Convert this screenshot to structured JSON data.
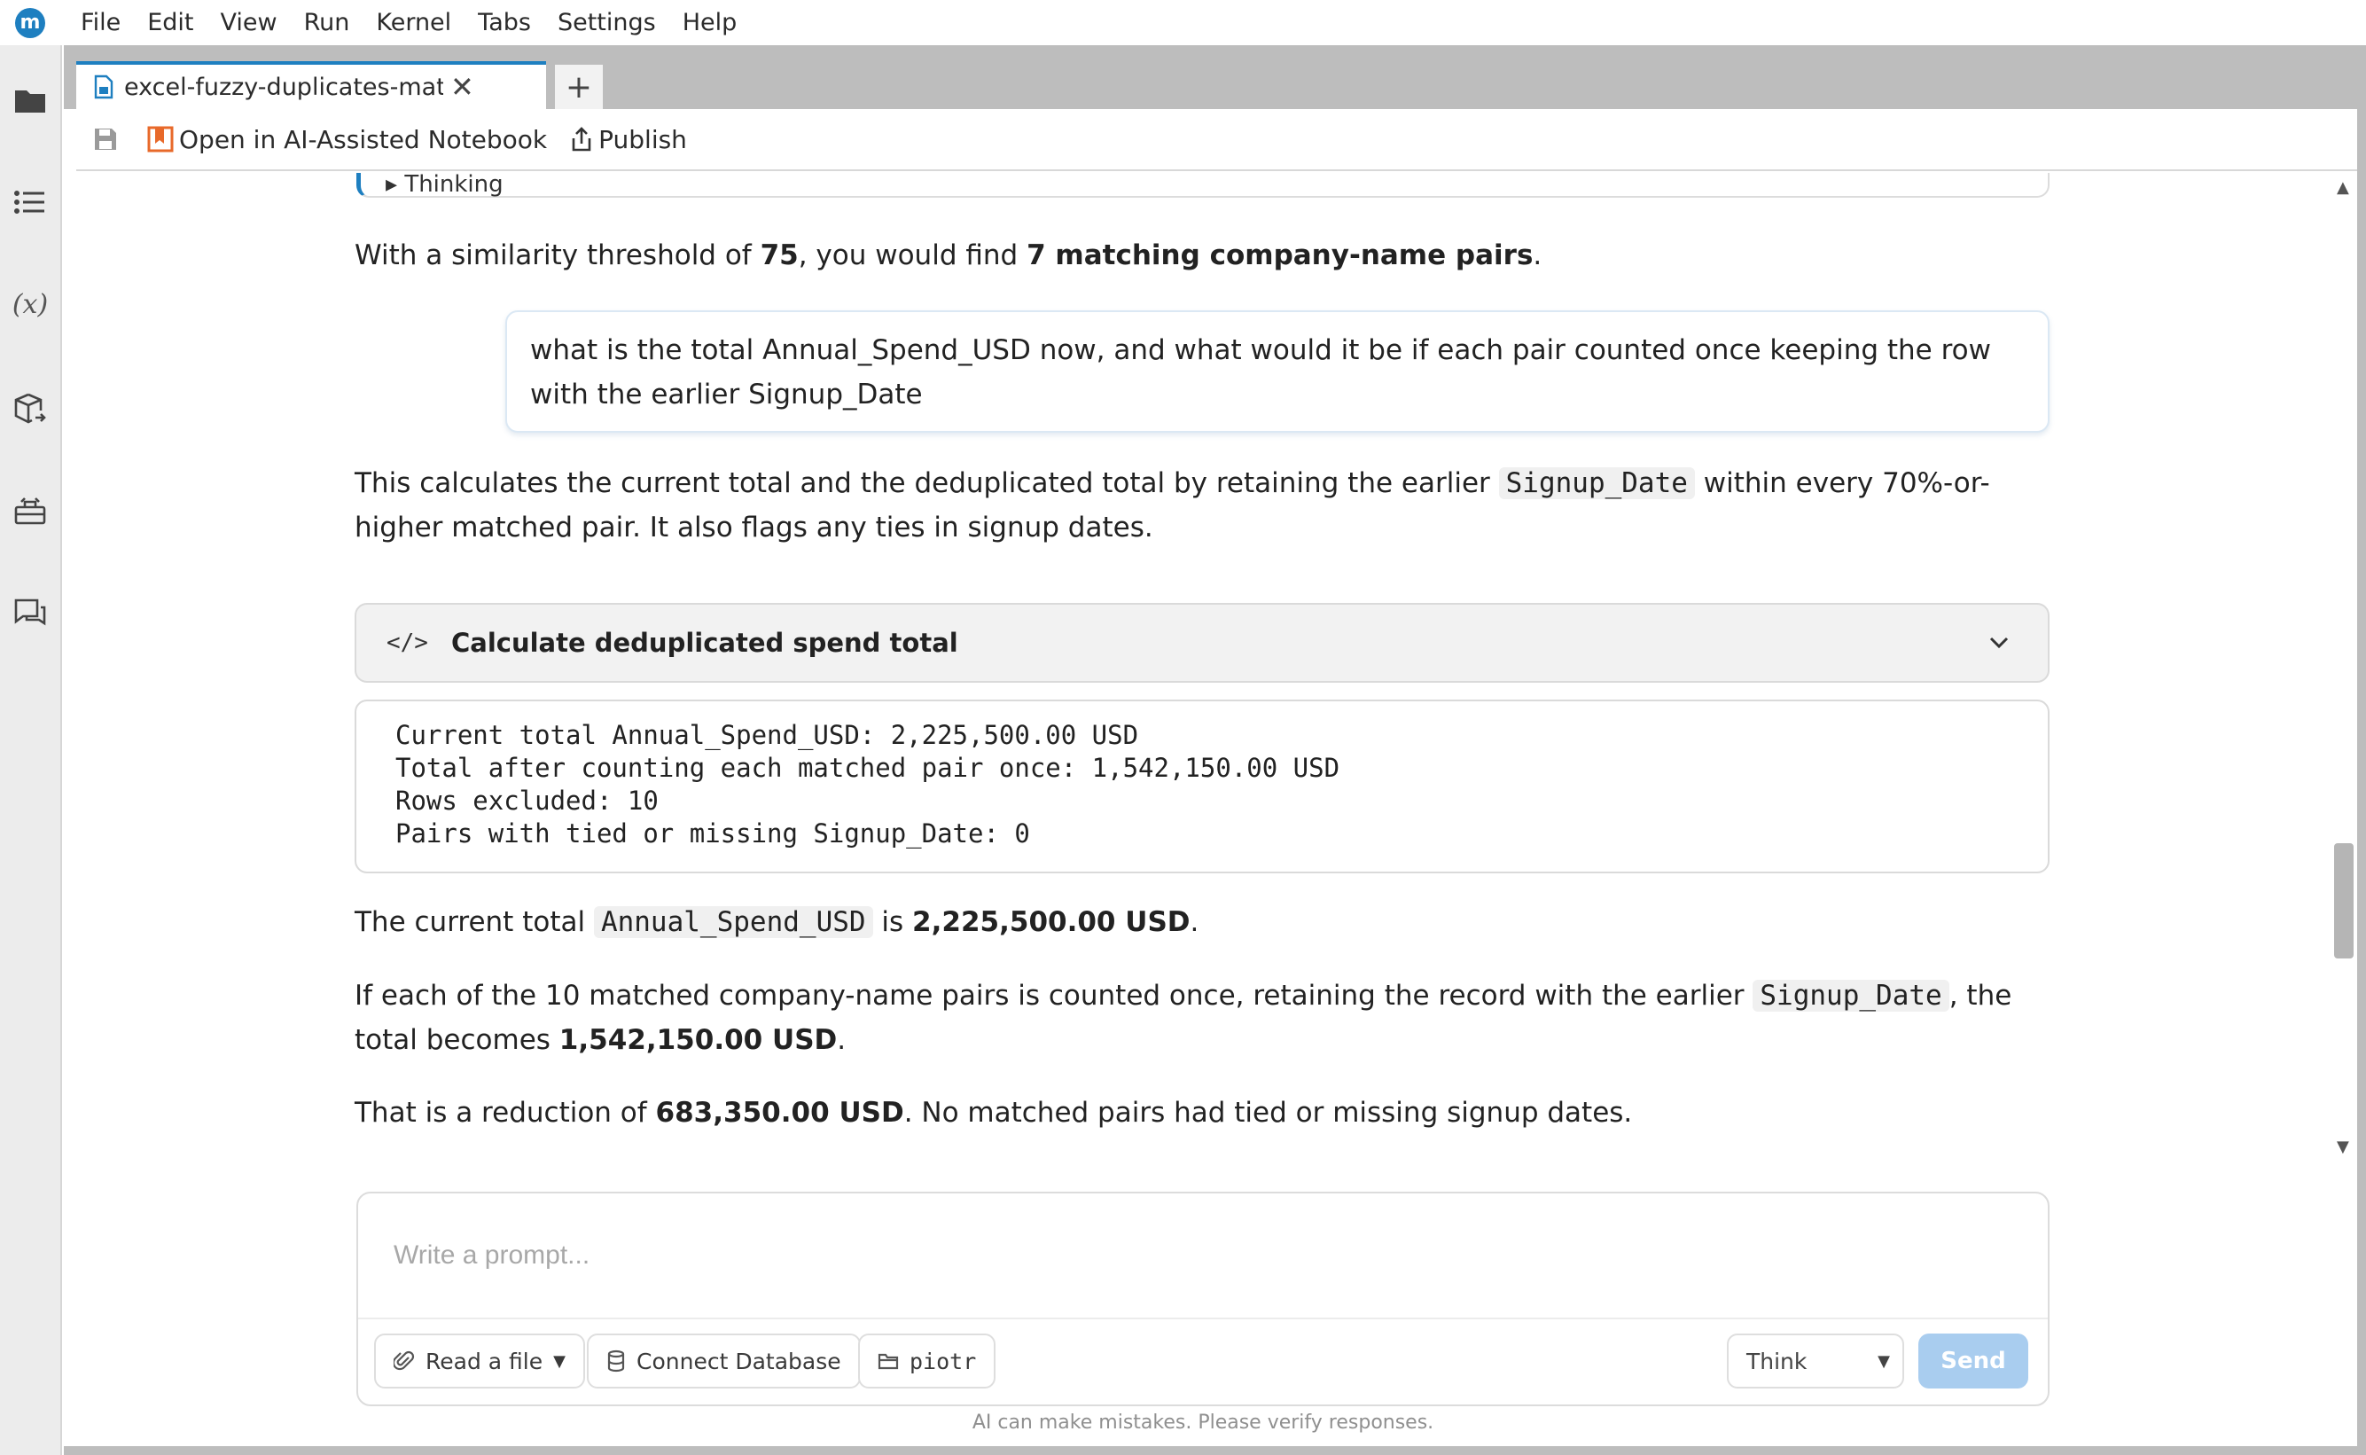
{
  "app": {
    "logo_letter": "m",
    "menu": [
      "File",
      "Edit",
      "View",
      "Run",
      "Kernel",
      "Tabs",
      "Settings",
      "Help"
    ]
  },
  "rail": {
    "icons": [
      "folder-icon",
      "list-icon",
      "variables-icon",
      "package-icon",
      "toolbox-icon",
      "chat-icon"
    ],
    "variables_text": "(x)"
  },
  "tabs": {
    "active_label": "excel-fuzzy-duplicates-match",
    "close_glyph": "✕",
    "new_tab_glyph": "+"
  },
  "toolbar": {
    "open_ai_label": "Open in AI-Assisted Notebook",
    "publish_label": "Publish"
  },
  "chat": {
    "prev_block_label": "▸ Thinking",
    "para1": {
      "pre": "With a similarity threshold of ",
      "b1": "75",
      "mid": ", you would find ",
      "b2": "7 matching company-name pairs",
      "post": "."
    },
    "user_message": "what is the total Annual_Spend_USD now, and what would it be if each pair counted once keeping the row with the earlier Signup_Date",
    "para2": {
      "pre": "This calculates the current total and the deduplicated total by retaining the earlier ",
      "code": "Signup_Date",
      "post": " within every 70%-or-higher matched pair. It also flags any ties in signup dates."
    },
    "code_block": {
      "tag": "</>",
      "title": "Calculate deduplicated spend total"
    },
    "output_lines": [
      "Current total Annual_Spend_USD: 2,225,500.00 USD",
      "Total after counting each matched pair once: 1,542,150.00 USD",
      "Rows excluded: 10",
      "Pairs with tied or missing Signup_Date: 0"
    ],
    "para3": {
      "pre": "The current total ",
      "code": "Annual_Spend_USD",
      "mid": " is ",
      "b1": "2,225,500.00 USD",
      "post": "."
    },
    "para4": {
      "pre": "If each of the 10 matched company-name pairs is counted once, retaining the record with the earlier ",
      "code": "Signup_Date",
      "mid": ", the total becomes ",
      "b1": "1,542,150.00 USD",
      "post": "."
    },
    "para5": {
      "pre": "That is a reduction of ",
      "b1": "683,350.00 USD",
      "post": ". No matched pairs had tied or missing signup dates."
    }
  },
  "composer": {
    "placeholder": "Write a prompt...",
    "read_file_label": "Read a file",
    "connect_db_label": "Connect Database",
    "folder_label": "piotr",
    "think_label": "Think",
    "send_label": "Send",
    "disclaimer": "AI can make mistakes. Please verify responses."
  },
  "colors": {
    "accent": "#1e7fc0",
    "send_disabled": "#a9cdef",
    "rail_bg": "#ececec",
    "tabstrip_bg": "#bdbdbd"
  }
}
